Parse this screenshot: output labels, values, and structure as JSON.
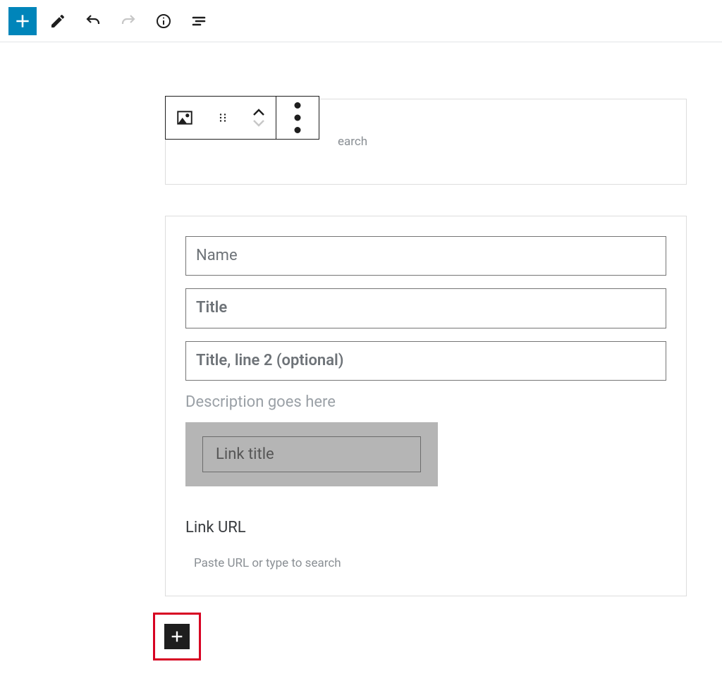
{
  "toolbar": {
    "insert_tooltip": "Add block",
    "edit_tooltip": "Tools",
    "undo_tooltip": "Undo",
    "redo_tooltip": "Redo",
    "info_tooltip": "Details",
    "outline_tooltip": "Outline"
  },
  "block_toolbar": {
    "block_type": "Profile",
    "move_up": "Move up",
    "move_down": "Move down",
    "drag": "Drag",
    "more": "Options"
  },
  "upper_block": {
    "url_placeholder": "earch"
  },
  "profile_block": {
    "name_placeholder": "Name",
    "title_placeholder": "Title",
    "title2_placeholder": "Title, line 2 (optional)",
    "description_placeholder": "Description goes here",
    "link_title_placeholder": "Link title",
    "link_url_label": "Link URL",
    "link_url_placeholder": "Paste URL or type to search"
  },
  "footer": {
    "add_block_tooltip": "Add block"
  }
}
